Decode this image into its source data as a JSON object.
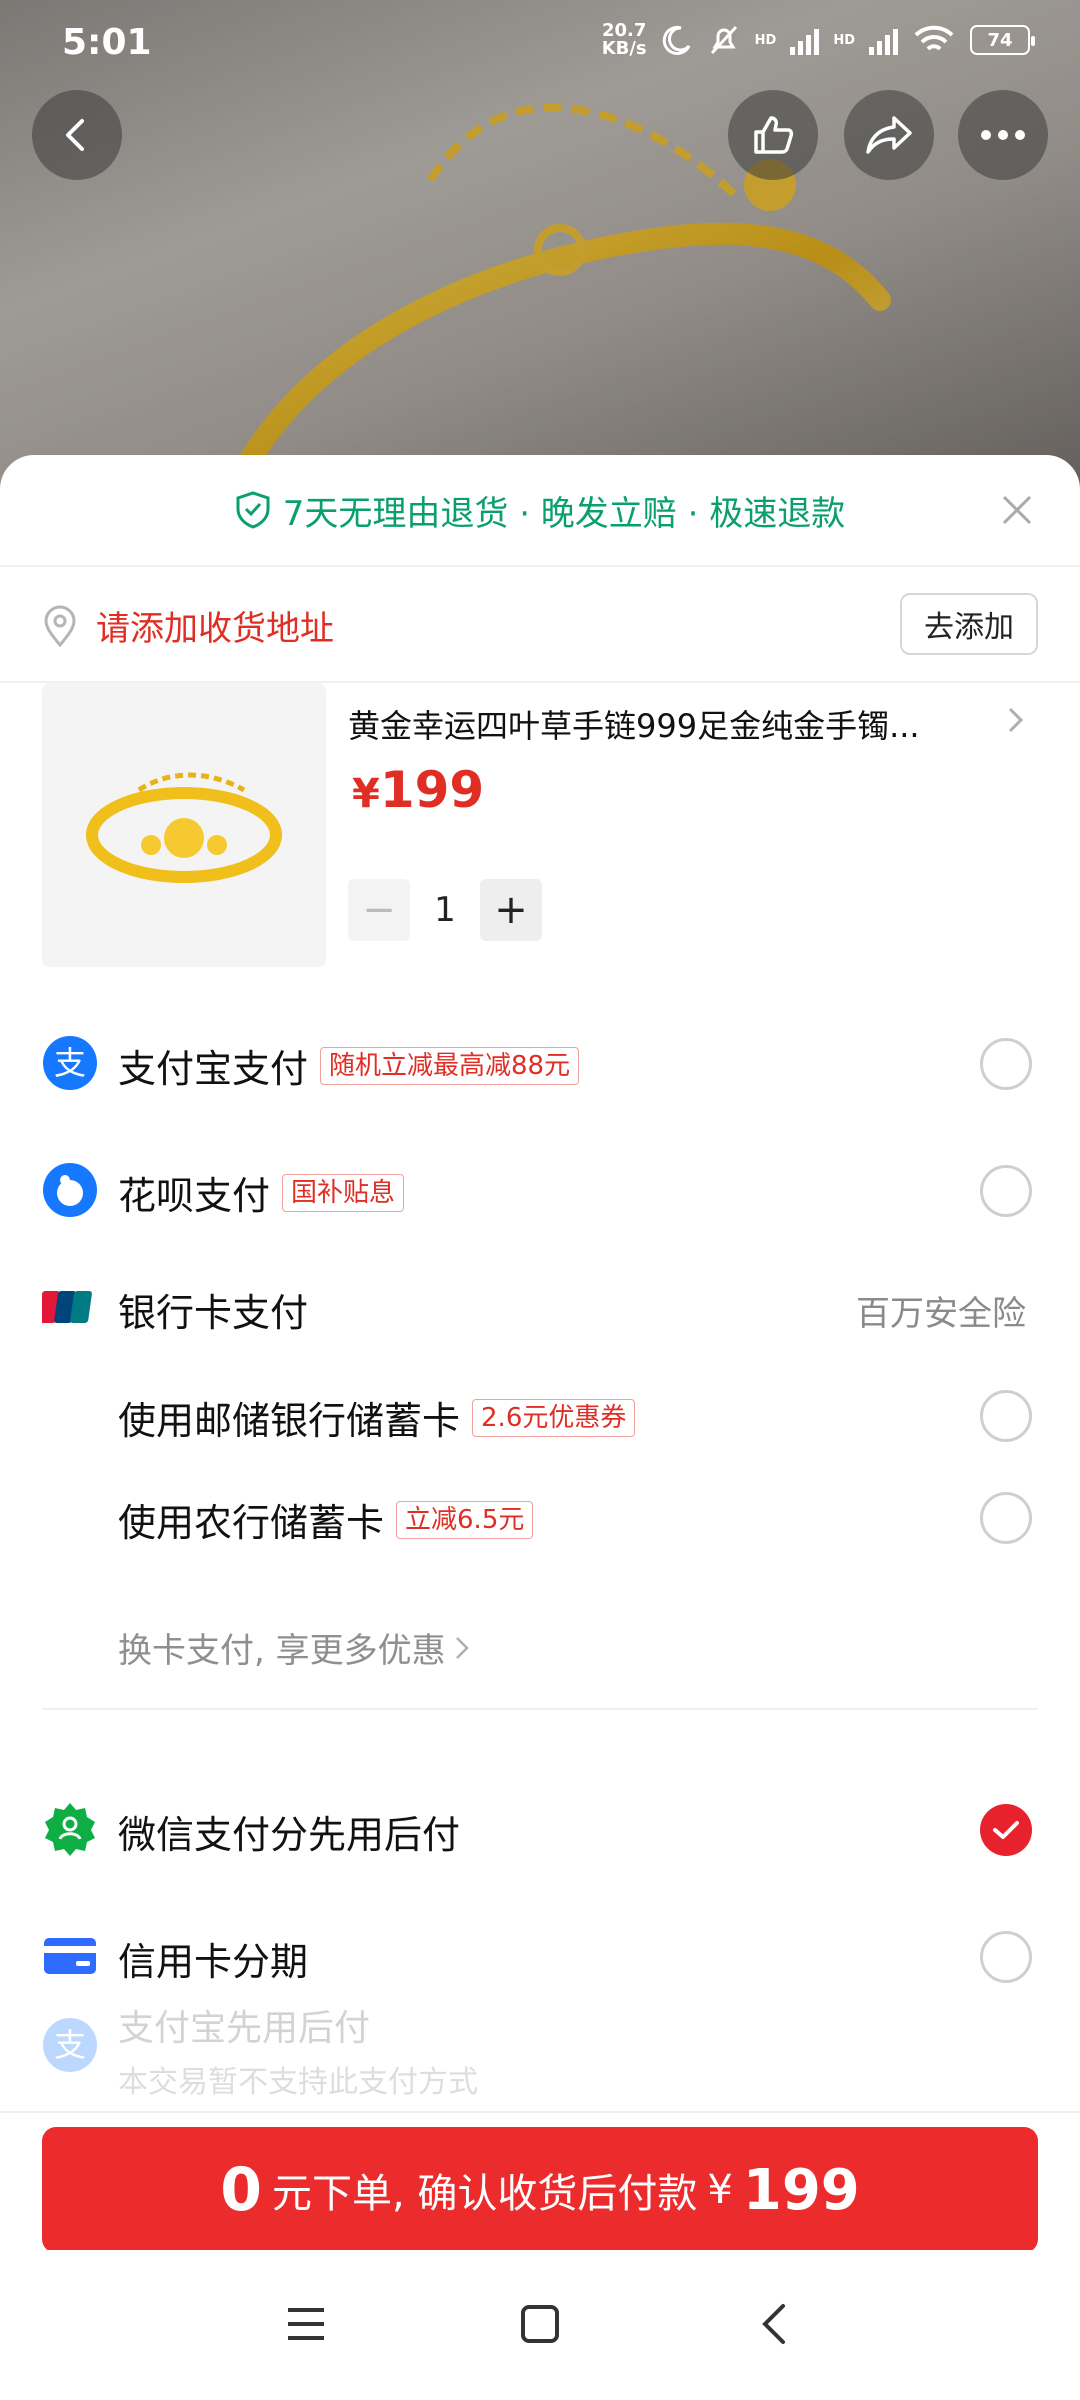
{
  "status_bar": {
    "time": "5:01",
    "net_speed_top": "20.7",
    "net_speed_bottom": "KB/s",
    "hd1": "HD",
    "hd2": "HD",
    "battery": "74"
  },
  "header_actions": {
    "back_icon": "chevron-left-icon",
    "like_icon": "thumbs-up-icon",
    "share_icon": "share-icon",
    "more_icon": "more-icon"
  },
  "guarantee": {
    "text": "7天无理由退货 · 晚发立赔 · 极速退款",
    "color": "#0a9f6f"
  },
  "address": {
    "prompt": "请添加收货地址",
    "button": "去添加"
  },
  "product": {
    "title": "黄金幸运四叶草手链999足金纯金手镯...",
    "currency": "¥",
    "price": "199",
    "quantity": "1",
    "minus": "−",
    "plus": "+"
  },
  "payments": {
    "alipay": {
      "label": "支付宝支付",
      "tag": "随机立减最高减88元"
    },
    "huabei": {
      "label": "花呗支付",
      "tag": "国补贴息"
    },
    "bankcard": {
      "label": "银行卡支付",
      "note": "百万安全险"
    },
    "psbc": {
      "label": "使用邮储银行储蓄卡",
      "tag": "2.6元优惠券"
    },
    "abc": {
      "label": "使用农行储蓄卡",
      "tag": "立减6.5元"
    },
    "more_cards": "换卡支付, 享更多优惠",
    "wechat": {
      "label": "微信支付分先用后付"
    },
    "credit": {
      "label": "信用卡分期"
    },
    "alipay_later": {
      "label": "支付宝先用后付",
      "sub": "本交易暂不支持此支付方式"
    }
  },
  "cta": {
    "zero": "0",
    "text": "元下单, 确认收货后付款",
    "currency": "¥",
    "amount": "199"
  },
  "colors": {
    "accent_red": "#e02e24",
    "button_red": "#ec2c2c",
    "alipay_blue": "#1677ff"
  }
}
